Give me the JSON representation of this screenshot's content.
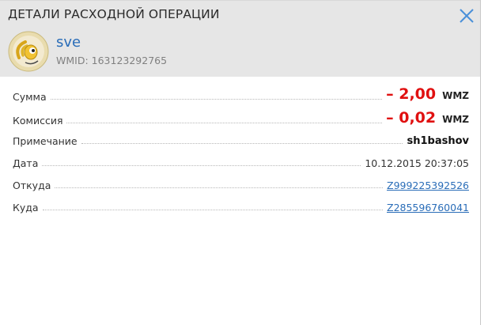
{
  "dialog": {
    "title": "ДЕТАЛИ РАСХОДНОЙ ОПЕРАЦИИ",
    "close_icon": "close-icon"
  },
  "user": {
    "avatar_icon": "webmoney-logo-icon",
    "name": "sve",
    "wmid": "WMID: 163123292765"
  },
  "details": {
    "sum": {
      "label": "Сумма",
      "value": "– 2,00",
      "currency": "WMZ"
    },
    "fee": {
      "label": "Комиссия",
      "value": "– 0,02",
      "currency": "WMZ"
    },
    "note": {
      "label": "Примечание",
      "value": "sh1bashov"
    },
    "date": {
      "label": "Дата",
      "value": "10.12.2015 20:37:05"
    },
    "from": {
      "label": "Откуда",
      "value": "Z999225392526"
    },
    "to": {
      "label": "Куда",
      "value": "Z285596760041"
    }
  },
  "colors": {
    "amount": "#e01010",
    "link": "#2a6db8",
    "header_bg": "#e6e6e6"
  }
}
